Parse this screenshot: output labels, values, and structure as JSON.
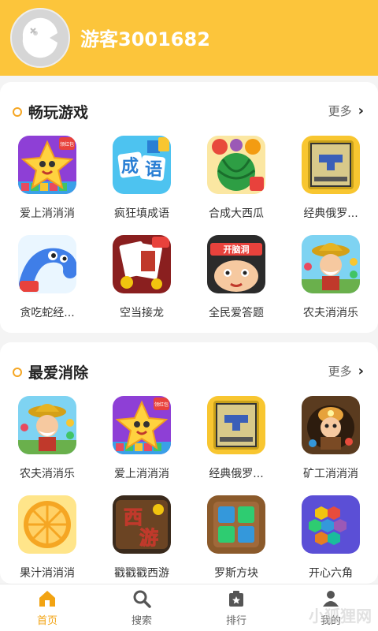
{
  "header": {
    "username": "游客3001682"
  },
  "sections": [
    {
      "title": "畅玩游戏",
      "more": "更多",
      "games": [
        {
          "name": "爱上消消消",
          "icon": "star-game-icon"
        },
        {
          "name": "疯狂填成语",
          "icon": "idiom-game-icon"
        },
        {
          "name": "合成大西瓜",
          "icon": "watermelon-game-icon"
        },
        {
          "name": "经典俄罗...",
          "icon": "tetris-game-icon"
        },
        {
          "name": "贪吃蛇经...",
          "icon": "snake-game-icon"
        },
        {
          "name": "空当接龙",
          "icon": "solitaire-game-icon"
        },
        {
          "name": "全民爱答题",
          "icon": "quiz-game-icon"
        },
        {
          "name": "农夫消消乐",
          "icon": "farmer-game-icon"
        }
      ]
    },
    {
      "title": "最爱消除",
      "more": "更多",
      "games": [
        {
          "name": "农夫消消乐",
          "icon": "farmer-game-icon"
        },
        {
          "name": "爱上消消消",
          "icon": "star-game-icon"
        },
        {
          "name": "经典俄罗...",
          "icon": "tetris-game-icon"
        },
        {
          "name": "矿工消消消",
          "icon": "miner-game-icon"
        },
        {
          "name": "果汁消消消",
          "icon": "orange-game-icon"
        },
        {
          "name": "戳戳戳西游",
          "icon": "xiyou-game-icon"
        },
        {
          "name": "罗斯方块",
          "icon": "blocks-game-icon"
        },
        {
          "name": "开心六角",
          "icon": "hexagon-game-icon"
        }
      ]
    }
  ],
  "icon_text": {
    "idiom": [
      "成",
      "语"
    ],
    "quiz_banner": "开脑洞",
    "xiyou": [
      "西",
      "游"
    ],
    "badge": "领红包"
  },
  "tabs": [
    {
      "label": "首页",
      "icon": "home-icon",
      "active": true
    },
    {
      "label": "搜索",
      "icon": "search-icon",
      "active": false
    },
    {
      "label": "排行",
      "icon": "ranking-icon",
      "active": false
    },
    {
      "label": "我的",
      "icon": "profile-icon",
      "active": false
    }
  ],
  "watermark": "小狐狸网",
  "colors": {
    "accent": "#fcc53b",
    "active_tab": "#f2a312",
    "ring": "#f5a623"
  }
}
